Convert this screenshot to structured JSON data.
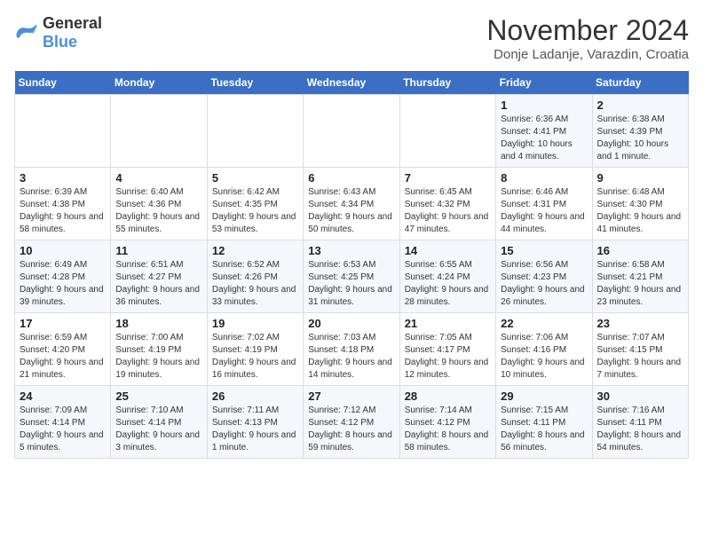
{
  "logo": {
    "general": "General",
    "blue": "Blue"
  },
  "header": {
    "month": "November 2024",
    "location": "Donje Ladanje, Varazdin, Croatia"
  },
  "days_of_week": [
    "Sunday",
    "Monday",
    "Tuesday",
    "Wednesday",
    "Thursday",
    "Friday",
    "Saturday"
  ],
  "weeks": [
    [
      {
        "day": "",
        "info": ""
      },
      {
        "day": "",
        "info": ""
      },
      {
        "day": "",
        "info": ""
      },
      {
        "day": "",
        "info": ""
      },
      {
        "day": "",
        "info": ""
      },
      {
        "day": "1",
        "info": "Sunrise: 6:36 AM\nSunset: 4:41 PM\nDaylight: 10 hours and 4 minutes."
      },
      {
        "day": "2",
        "info": "Sunrise: 6:38 AM\nSunset: 4:39 PM\nDaylight: 10 hours and 1 minute."
      }
    ],
    [
      {
        "day": "3",
        "info": "Sunrise: 6:39 AM\nSunset: 4:38 PM\nDaylight: 9 hours and 58 minutes."
      },
      {
        "day": "4",
        "info": "Sunrise: 6:40 AM\nSunset: 4:36 PM\nDaylight: 9 hours and 55 minutes."
      },
      {
        "day": "5",
        "info": "Sunrise: 6:42 AM\nSunset: 4:35 PM\nDaylight: 9 hours and 53 minutes."
      },
      {
        "day": "6",
        "info": "Sunrise: 6:43 AM\nSunset: 4:34 PM\nDaylight: 9 hours and 50 minutes."
      },
      {
        "day": "7",
        "info": "Sunrise: 6:45 AM\nSunset: 4:32 PM\nDaylight: 9 hours and 47 minutes."
      },
      {
        "day": "8",
        "info": "Sunrise: 6:46 AM\nSunset: 4:31 PM\nDaylight: 9 hours and 44 minutes."
      },
      {
        "day": "9",
        "info": "Sunrise: 6:48 AM\nSunset: 4:30 PM\nDaylight: 9 hours and 41 minutes."
      }
    ],
    [
      {
        "day": "10",
        "info": "Sunrise: 6:49 AM\nSunset: 4:28 PM\nDaylight: 9 hours and 39 minutes."
      },
      {
        "day": "11",
        "info": "Sunrise: 6:51 AM\nSunset: 4:27 PM\nDaylight: 9 hours and 36 minutes."
      },
      {
        "day": "12",
        "info": "Sunrise: 6:52 AM\nSunset: 4:26 PM\nDaylight: 9 hours and 33 minutes."
      },
      {
        "day": "13",
        "info": "Sunrise: 6:53 AM\nSunset: 4:25 PM\nDaylight: 9 hours and 31 minutes."
      },
      {
        "day": "14",
        "info": "Sunrise: 6:55 AM\nSunset: 4:24 PM\nDaylight: 9 hours and 28 minutes."
      },
      {
        "day": "15",
        "info": "Sunrise: 6:56 AM\nSunset: 4:23 PM\nDaylight: 9 hours and 26 minutes."
      },
      {
        "day": "16",
        "info": "Sunrise: 6:58 AM\nSunset: 4:21 PM\nDaylight: 9 hours and 23 minutes."
      }
    ],
    [
      {
        "day": "17",
        "info": "Sunrise: 6:59 AM\nSunset: 4:20 PM\nDaylight: 9 hours and 21 minutes."
      },
      {
        "day": "18",
        "info": "Sunrise: 7:00 AM\nSunset: 4:19 PM\nDaylight: 9 hours and 19 minutes."
      },
      {
        "day": "19",
        "info": "Sunrise: 7:02 AM\nSunset: 4:19 PM\nDaylight: 9 hours and 16 minutes."
      },
      {
        "day": "20",
        "info": "Sunrise: 7:03 AM\nSunset: 4:18 PM\nDaylight: 9 hours and 14 minutes."
      },
      {
        "day": "21",
        "info": "Sunrise: 7:05 AM\nSunset: 4:17 PM\nDaylight: 9 hours and 12 minutes."
      },
      {
        "day": "22",
        "info": "Sunrise: 7:06 AM\nSunset: 4:16 PM\nDaylight: 9 hours and 10 minutes."
      },
      {
        "day": "23",
        "info": "Sunrise: 7:07 AM\nSunset: 4:15 PM\nDaylight: 9 hours and 7 minutes."
      }
    ],
    [
      {
        "day": "24",
        "info": "Sunrise: 7:09 AM\nSunset: 4:14 PM\nDaylight: 9 hours and 5 minutes."
      },
      {
        "day": "25",
        "info": "Sunrise: 7:10 AM\nSunset: 4:14 PM\nDaylight: 9 hours and 3 minutes."
      },
      {
        "day": "26",
        "info": "Sunrise: 7:11 AM\nSunset: 4:13 PM\nDaylight: 9 hours and 1 minute."
      },
      {
        "day": "27",
        "info": "Sunrise: 7:12 AM\nSunset: 4:12 PM\nDaylight: 8 hours and 59 minutes."
      },
      {
        "day": "28",
        "info": "Sunrise: 7:14 AM\nSunset: 4:12 PM\nDaylight: 8 hours and 58 minutes."
      },
      {
        "day": "29",
        "info": "Sunrise: 7:15 AM\nSunset: 4:11 PM\nDaylight: 8 hours and 56 minutes."
      },
      {
        "day": "30",
        "info": "Sunrise: 7:16 AM\nSunset: 4:11 PM\nDaylight: 8 hours and 54 minutes."
      }
    ]
  ]
}
